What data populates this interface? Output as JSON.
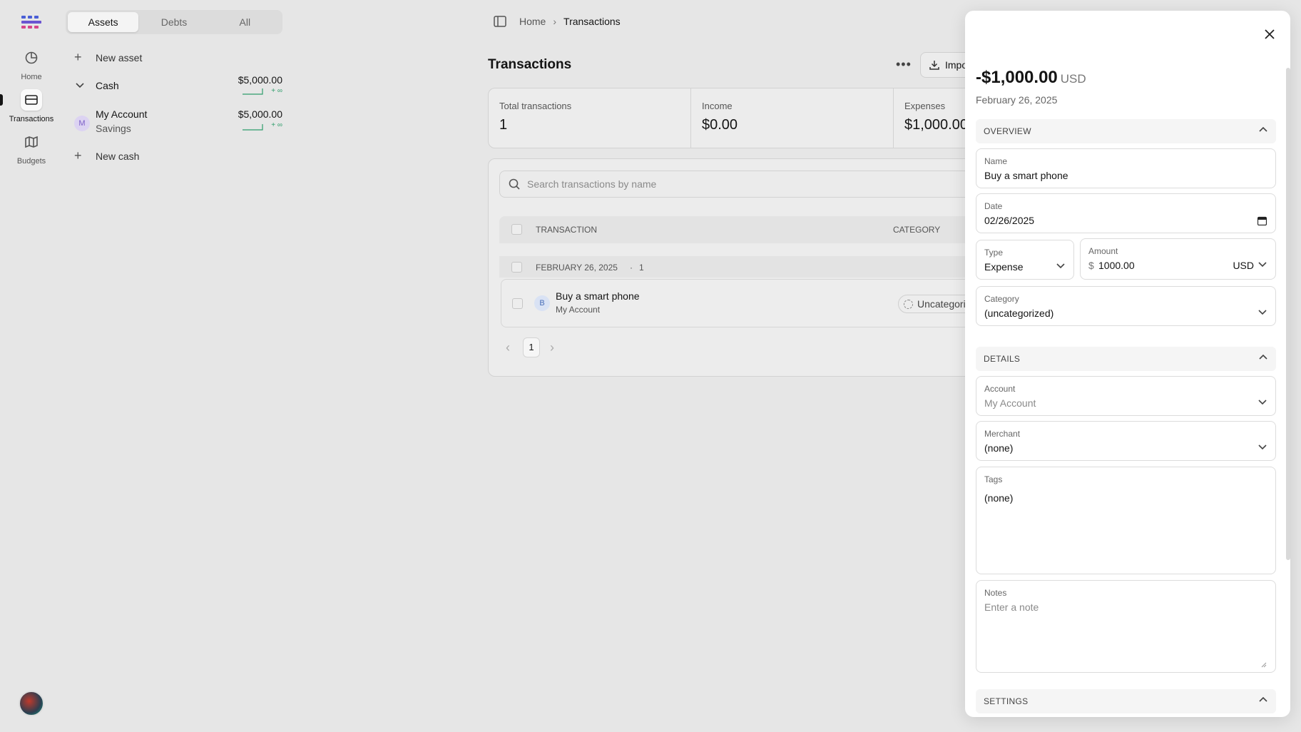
{
  "rail": {
    "items": [
      {
        "label": "Home",
        "icon": "clock-icon"
      },
      {
        "label": "Transactions",
        "icon": "credit-card-icon"
      },
      {
        "label": "Budgets",
        "icon": "map-icon"
      }
    ]
  },
  "accounts": {
    "tabs": [
      "Assets",
      "Debts",
      "All"
    ],
    "new_asset": "New asset",
    "group_name": "Cash",
    "group_total": "$5,000.00",
    "account_name": "My Account",
    "account_type": "Savings",
    "account_initial": "M",
    "account_balance": "$5,000.00",
    "trend_label": "+ ∞",
    "new_cash": "New cash"
  },
  "breadcrumb": {
    "home": "Home",
    "current": "Transactions"
  },
  "main": {
    "title": "Transactions",
    "import_label": "Import",
    "stats": [
      {
        "label": "Total transactions",
        "value": "1"
      },
      {
        "label": "Income",
        "value": "$0.00"
      },
      {
        "label": "Expenses",
        "value": "$1,000.00"
      }
    ],
    "search_placeholder": "Search transactions by name",
    "col_transaction": "TRANSACTION",
    "col_category": "CATEGORY",
    "group_date": "FEBRUARY 26, 2025",
    "group_count": "1",
    "row": {
      "initial": "B",
      "name": "Buy a smart phone",
      "account": "My Account",
      "category": "Uncategorized"
    },
    "page": "1"
  },
  "drawer": {
    "amount": "-$1,000.00",
    "currency": "USD",
    "date": "February 26, 2025",
    "overview": "OVERVIEW",
    "name_label": "Name",
    "name_value": "Buy a smart phone",
    "date_label": "Date",
    "date_value": "02/26/2025",
    "type_label": "Type",
    "type_value": "Expense",
    "amount_label": "Amount",
    "amount_symbol": "$",
    "amount_value": "1000.00",
    "amount_currency": "USD",
    "category_label": "Category",
    "category_value": "(uncategorized)",
    "details": "DETAILS",
    "account_label": "Account",
    "account_value": "My Account",
    "merchant_label": "Merchant",
    "merchant_value": "(none)",
    "tags_label": "Tags",
    "tags_value": "(none)",
    "notes_label": "Notes",
    "notes_placeholder": "Enter a note",
    "settings": "SETTINGS"
  }
}
